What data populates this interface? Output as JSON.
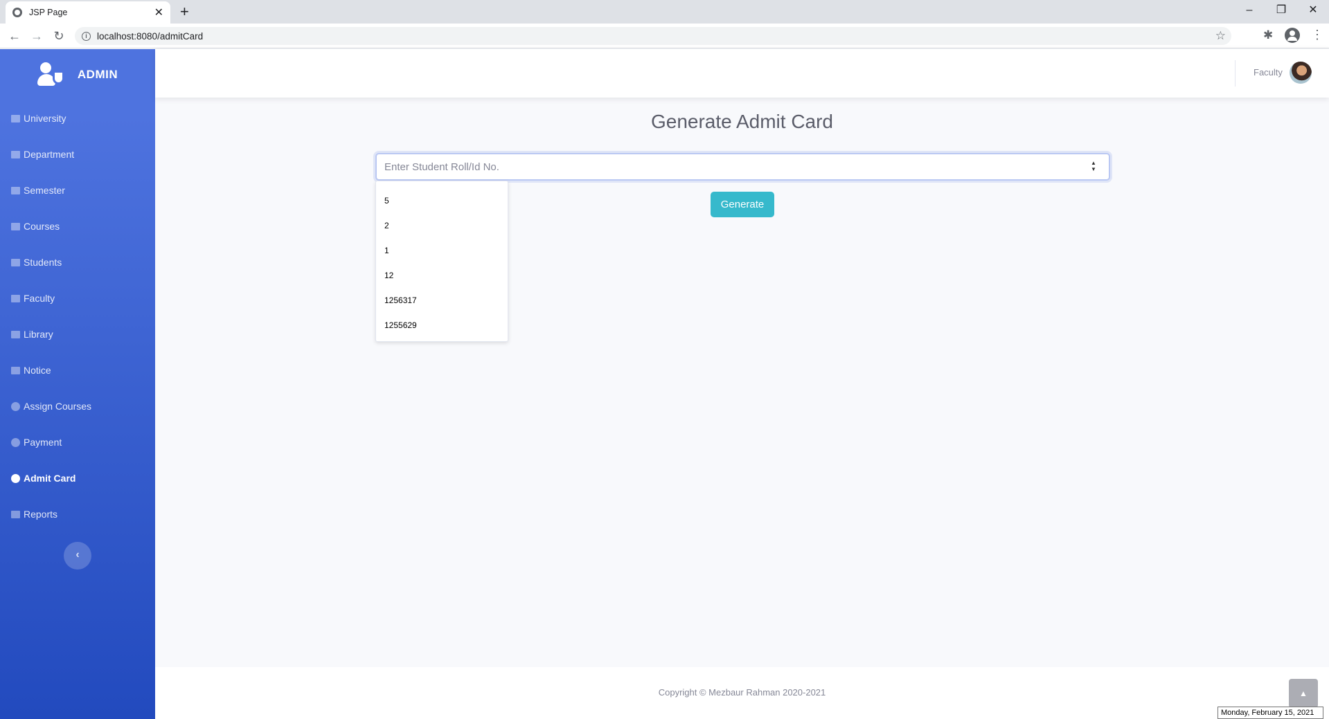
{
  "browser": {
    "tab_title": "JSP Page",
    "tab_close": "✕",
    "new_tab": "+",
    "url": "localhost:8080/admitCard",
    "minimize": "–",
    "restore": "❐",
    "close": "✕",
    "back": "←",
    "forward": "→",
    "reload": "↻",
    "star": "☆",
    "extensions": "✱",
    "menu": "⋮"
  },
  "sidebar": {
    "brand": "ADMIN",
    "items": [
      {
        "label": "University",
        "icon": "university-icon",
        "active": false
      },
      {
        "label": "Department",
        "icon": "id-card-icon",
        "active": false
      },
      {
        "label": "Semester",
        "icon": "table-icon",
        "active": false
      },
      {
        "label": "Courses",
        "icon": "table-icon",
        "active": false
      },
      {
        "label": "Students",
        "icon": "graduation-cap-icon",
        "active": false
      },
      {
        "label": "Faculty",
        "icon": "table-icon",
        "active": false
      },
      {
        "label": "Library",
        "icon": "book-icon",
        "active": false
      },
      {
        "label": "Notice",
        "icon": "flag-icon",
        "active": false
      },
      {
        "label": "Assign Courses",
        "icon": "circle-icon",
        "active": false
      },
      {
        "label": "Payment",
        "icon": "circle-icon",
        "active": false
      },
      {
        "label": "Admit Card",
        "icon": "circle-icon",
        "active": true
      },
      {
        "label": "Reports",
        "icon": "file-icon",
        "active": false
      }
    ],
    "toggle": "‹"
  },
  "topbar": {
    "user_name": "Faculty"
  },
  "main": {
    "title": "Generate Admit Card",
    "input_placeholder": "Enter Student Roll/Id No.",
    "input_value": "",
    "suggestions": [
      "5",
      "2",
      "1",
      "12",
      "1256317",
      "1255629"
    ],
    "generate_label": "Generate"
  },
  "footer": {
    "copyright": "Copyright © Mezbaur Rahman 2020-2021",
    "scroll_top": "▲",
    "date_tooltip": "Monday, February 15, 2021"
  },
  "colors": {
    "sidebar_primary": "#4e73df",
    "sidebar_dark": "#224abe",
    "button_info": "#36b9cc",
    "background": "#f8f9fc"
  }
}
